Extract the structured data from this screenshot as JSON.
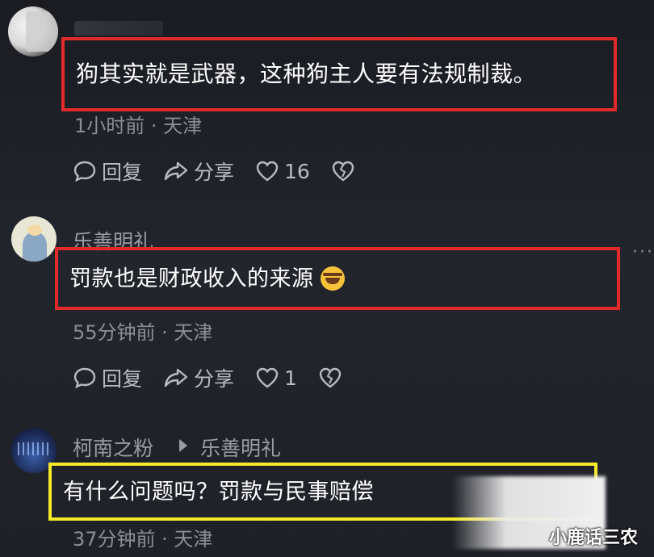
{
  "comments": [
    {
      "username": "",
      "text": "狗其实就是武器，这种狗主人要有法规制裁。",
      "meta": "1小时前 · 天津",
      "actions": {
        "reply": "回复",
        "share": "分享",
        "likes": "16"
      }
    },
    {
      "username": "乐善明礼",
      "text": "罚款也是财政收入的来源",
      "emoji": "rolling-on-floor-laughing",
      "meta": "55分钟前 · 天津",
      "actions": {
        "reply": "回复",
        "share": "分享",
        "likes": "1"
      }
    },
    {
      "username": "柯南之粉",
      "reply_to": "乐善明礼",
      "text": "有什么问题吗？罚款与民事赔偿",
      "meta": "37分钟前 · 天津"
    }
  ],
  "watermark": "小鹿话三农",
  "colors": {
    "highlight_red": "#e22a2a",
    "highlight_yellow": "#f5ea2a",
    "background": "#1d1f26",
    "meta_text": "#8c8e96"
  },
  "icons": [
    "comment-icon",
    "share-icon",
    "heart-icon",
    "broken-heart-icon",
    "more-dots-icon"
  ]
}
